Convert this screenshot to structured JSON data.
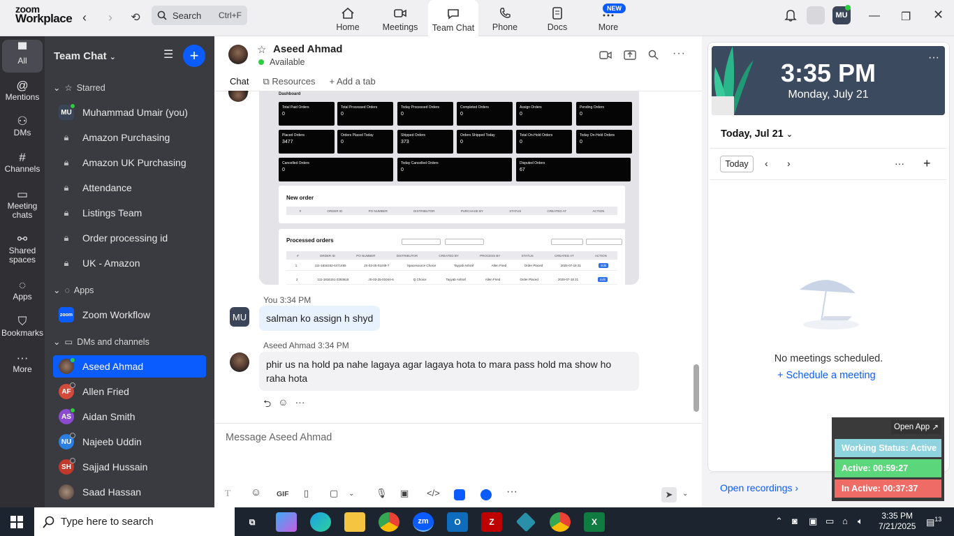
{
  "window": {
    "brand_top": "zoom",
    "brand_bottom": "Workplace",
    "search_label": "Search",
    "search_shortcut": "Ctrl+F"
  },
  "top_tabs": [
    {
      "label": "Home",
      "icon": "home-icon"
    },
    {
      "label": "Meetings",
      "icon": "video-icon"
    },
    {
      "label": "Team Chat",
      "icon": "chat-icon"
    },
    {
      "label": "Phone",
      "icon": "phone-icon"
    },
    {
      "label": "Docs",
      "icon": "docs-icon"
    },
    {
      "label": "More",
      "icon": "more-icon"
    }
  ],
  "new_badge": "NEW",
  "profile_initials": "MU",
  "rail": [
    {
      "label": "All",
      "icon": "chat-icon"
    },
    {
      "label": "Mentions",
      "icon": "at-icon"
    },
    {
      "label": "DMs",
      "icon": "people-icon"
    },
    {
      "label": "Channels",
      "icon": "hash-icon"
    },
    {
      "label": "Meeting chats",
      "icon": "calendar-icon"
    },
    {
      "label": "Shared spaces",
      "icon": "share-icon"
    },
    {
      "label": "Apps",
      "icon": "apps-icon"
    },
    {
      "label": "Bookmarks",
      "icon": "bookmark-icon"
    },
    {
      "label": "More",
      "icon": "more-icon"
    }
  ],
  "sidebar": {
    "title": "Team Chat",
    "starred_label": "Starred",
    "starred": [
      {
        "label": "Muhammad Umair (you)",
        "initials": "MU"
      },
      {
        "label": "Amazon Purchasing"
      },
      {
        "label": "Amazon UK Purchasing"
      },
      {
        "label": "Attendance"
      },
      {
        "label": "Listings Team"
      },
      {
        "label": "Order processing id"
      },
      {
        "label": "UK - Amazon"
      }
    ],
    "apps_label": "Apps",
    "apps": [
      {
        "label": "Zoom Workflow",
        "initials": "zoom"
      }
    ],
    "dms_label": "DMs and channels",
    "dms": [
      {
        "label": "Aseed Ahmad",
        "initials": "",
        "color": "#5a3f33"
      },
      {
        "label": "Allen Fried",
        "initials": "AF",
        "color": "#d14a3a"
      },
      {
        "label": "Aidan Smith",
        "initials": "AS",
        "color": "#8a4bd0"
      },
      {
        "label": "Najeeb Uddin",
        "initials": "NU",
        "color": "#2a7fe0"
      },
      {
        "label": "Sajjad Hussain",
        "initials": "SH",
        "color": "#c0392b"
      },
      {
        "label": "Saad Hassan",
        "initials": "",
        "color": "#6a5a50"
      }
    ]
  },
  "chat": {
    "name": "Aseed Ahmad",
    "status": "Available",
    "tabs": [
      {
        "label": "Chat"
      },
      {
        "label": "Resources"
      },
      {
        "label": "Add a tab"
      }
    ],
    "screenshot": {
      "dashboard": "Dashboard",
      "cards": [
        {
          "t": "Total Paid Orders",
          "v": "0"
        },
        {
          "t": "Total Processed Orders",
          "v": "0"
        },
        {
          "t": "Today Processed Orders",
          "v": "0"
        },
        {
          "t": "Completed Orders",
          "v": "0"
        },
        {
          "t": "Assign Orders",
          "v": "0"
        },
        {
          "t": "Pending Orders",
          "v": "0"
        },
        {
          "t": "Placed Orders",
          "v": "3477"
        },
        {
          "t": "Orders Placed Today",
          "v": "0"
        },
        {
          "t": "Shipped Orders",
          "v": "373"
        },
        {
          "t": "Orders Shipped Today",
          "v": "0"
        },
        {
          "t": "Total On-Hold Orders",
          "v": "0"
        },
        {
          "t": "Today On-Hold Orders",
          "v": "0"
        },
        {
          "t": "Cancelled Orders",
          "v": "0"
        },
        {
          "t": "Today Cancelled Orders",
          "v": "0"
        },
        {
          "t": "Disputed Orders",
          "v": "67"
        }
      ],
      "new_order": "New order",
      "new_cols": [
        "#",
        "ORDER ID",
        "PO NUMBER",
        "DISTRIBUTOR",
        "PURCHASE BY",
        "STATUS",
        "CREATED AT",
        "ACTION"
      ],
      "processed": "Processed orders",
      "proc_cols": [
        "#",
        "ORDER ID",
        "PO NUMBER",
        "DISTRIBUTOR",
        "CREATED BY",
        "PROCESS BY",
        "STATUS",
        "CREATED AT",
        "ACTION"
      ],
      "rows": [
        [
          "1",
          "111-1816152-4471455",
          "JS-03-25-01045-7",
          "Spacesource Choice",
          "Tayyab Ashraf",
          "Allen Fried",
          "Order Placed",
          "2025-07-18 21",
          "Edit"
        ],
        [
          "2",
          "111-1816151-2283618",
          "JS-03-25-01044-6",
          "Q Choice",
          "Tayyab Ashraf",
          "Allen Fried",
          "Order Placed",
          "2025-07-18 21",
          "Edit"
        ]
      ],
      "edit": "Edit"
    },
    "messages": [
      {
        "sender": "You",
        "time": "3:34 PM",
        "initials": "MU",
        "text": "salman ko assign h shyd"
      },
      {
        "sender": "Aseed Ahmad",
        "time": "3:34 PM",
        "text": "phir us na hold pa nahe lagaya agar lagaya hota to mara pass hold ma show ho raha hota"
      }
    ],
    "composer_placeholder": "Message Aseed Ahmad",
    "gif_label": "GIF"
  },
  "calendar": {
    "time": "3:35 PM",
    "date": "Monday, July 21",
    "header": "Today, Jul 21",
    "today_btn": "Today",
    "no_meetings": "No meetings scheduled.",
    "schedule": "Schedule a meeting",
    "open_recordings": "Open recordings"
  },
  "status_widget": {
    "open_app": "Open App",
    "working": "Working Status: Active",
    "active": "Active: 00:59:27",
    "inactive": "In Active: 00:37:37",
    "colors": {
      "working": "#8fd3df",
      "active": "#5cd67a",
      "inactive": "#ee6b66"
    }
  },
  "taskbar": {
    "search": "Type here to search",
    "time": "3:35 PM",
    "date": "7/21/2025",
    "notif": "13"
  }
}
